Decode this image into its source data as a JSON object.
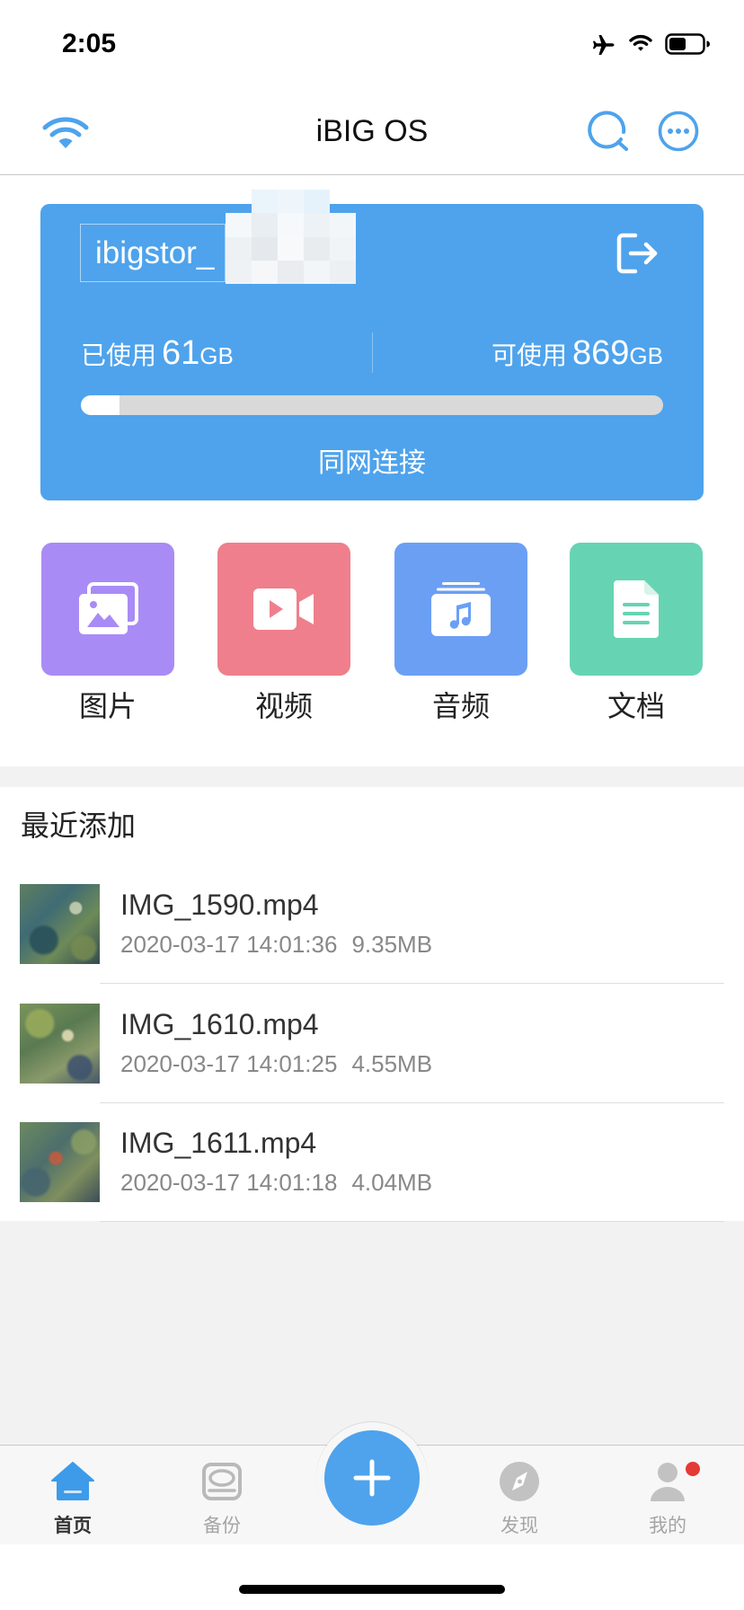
{
  "status_bar": {
    "time": "2:05",
    "icons": [
      "airplane-icon",
      "wifi-icon",
      "battery-icon"
    ]
  },
  "nav": {
    "title": "iBIG OS",
    "left_icon": "wifi-icon",
    "right_icons": [
      "search-icon",
      "more-icon"
    ]
  },
  "accent_color": "#4ea3ec",
  "storage_card": {
    "background_color": "#4ea3ec",
    "device_name": "ibigstor_",
    "logout_icon": "logout-icon",
    "used": {
      "label": "已使用",
      "value": "61",
      "unit": "GB"
    },
    "available": {
      "label": "可使用",
      "value": "869",
      "unit": "GB"
    },
    "usage_fraction": 0.066,
    "connection_mode": "同网连接"
  },
  "categories": [
    {
      "label": "图片",
      "icon": "image-icon",
      "color": "#a98bf6"
    },
    {
      "label": "视频",
      "icon": "video-icon",
      "color": "#ef7f8c"
    },
    {
      "label": "音频",
      "icon": "music-icon",
      "color": "#6b9ff4"
    },
    {
      "label": "文档",
      "icon": "document-icon",
      "color": "#66d4b3"
    }
  ],
  "recent": {
    "title": "最近添加",
    "items": [
      {
        "name": "IMG_1590.mp4",
        "date": "2020-03-17 14:01:36",
        "size": "9.35MB"
      },
      {
        "name": "IMG_1610.mp4",
        "date": "2020-03-17 14:01:25",
        "size": "4.55MB"
      },
      {
        "name": "IMG_1611.mp4",
        "date": "2020-03-17 14:01:18",
        "size": "4.04MB"
      }
    ]
  },
  "tab_bar": {
    "active_color": "#3d9be9",
    "inactive_color": "#a5a5a5",
    "center_button_icon": "plus-icon",
    "items": [
      {
        "label": "首页",
        "icon": "home-icon",
        "active": true
      },
      {
        "label": "备份",
        "icon": "backup-drive-icon",
        "active": false
      },
      {
        "label": "发现",
        "icon": "compass-icon",
        "active": false
      },
      {
        "label": "我的",
        "icon": "profile-icon",
        "active": false,
        "badge": true
      }
    ]
  }
}
